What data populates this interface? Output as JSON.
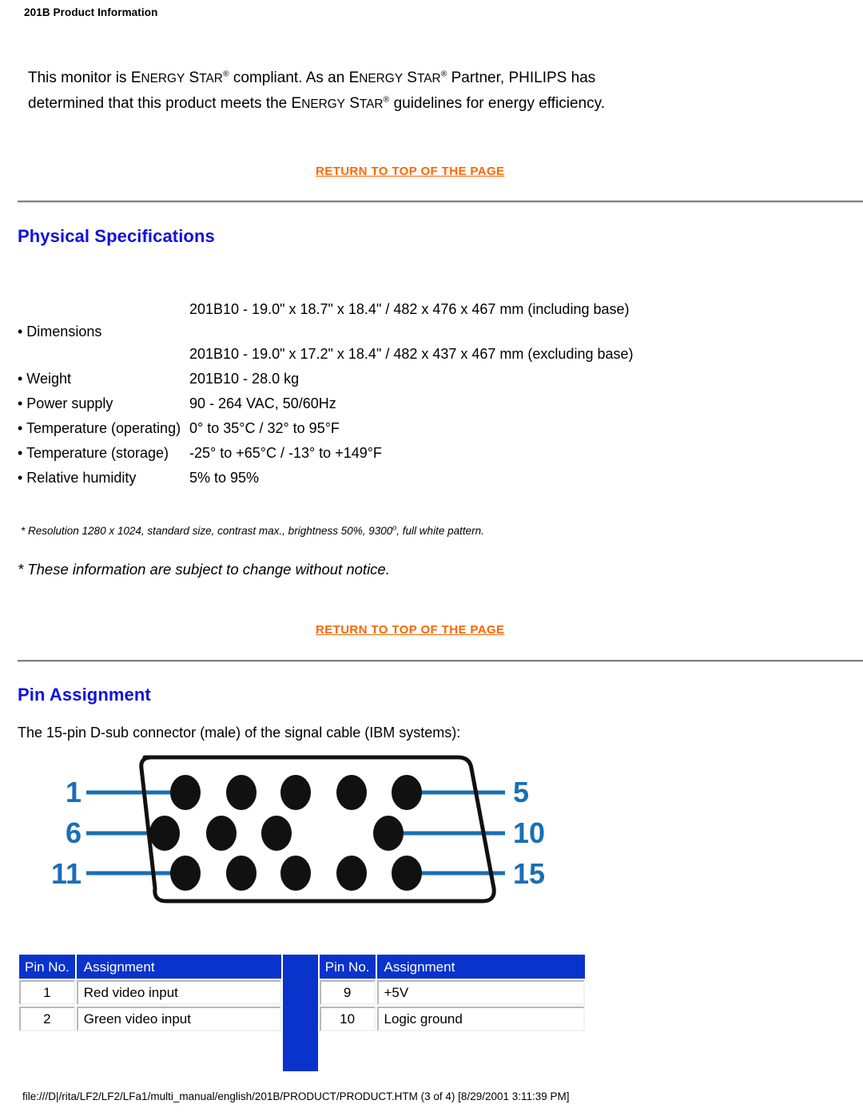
{
  "document": {
    "header_title": "201B Product Information",
    "footer_path": "file:///D|/rita/LF2/LF2/LFa1/multi_manual/english/201B/PRODUCT/PRODUCT.HTM (3 of 4) [8/29/2001 3:11:39 PM]"
  },
  "colors": {
    "link_orange": "#ff6600",
    "heading_blue": "#1111dd",
    "table_header_blue": "#0a33cc",
    "diagram_blue": "#1a6fb5",
    "rule_gray": "#808080"
  },
  "intro": {
    "part1": "This monitor is ",
    "energy_star_1": "ENERGY STAR",
    "part2": " compliant. ",
    "as_an": "As an ",
    "energy_star_2": "ENERGY STAR",
    "part3": " Partner, ",
    "philips": "PHILIPS",
    "part4": " has determined that this product meets the ",
    "energy_star_3": "ENERGY STAR",
    "part5": " guidelines for energy efficiency.",
    "registered_mark": "®"
  },
  "links": {
    "return_to_top": "RETURN TO TOP OF THE PAGE"
  },
  "sections": {
    "physical_specifications": "Physical Specifications",
    "pin_assignment": "Pin Assignment"
  },
  "specs": {
    "rows": [
      {
        "label": "• Dimensions",
        "values": [
          "201B10 - 19.0\" x 18.7\" x 18.4\" / 482 x 476 x 467 mm (including base)",
          "201B10 - 19.0\" x 17.2\" x 18.4\" / 482 x 437 x 467 mm (excluding base)"
        ]
      },
      {
        "label": "• Weight",
        "values": [
          "201B10 - 28.0 kg"
        ]
      },
      {
        "label": "• Power supply",
        "values": [
          "90 - 264 VAC, 50/60Hz"
        ]
      },
      {
        "label": "• Temperature (operating)",
        "values": [
          "0° to 35°C / 32° to 95°F"
        ]
      },
      {
        "label": "• Temperature (storage)",
        "values": [
          "-25° to +65°C / -13° to +149°F"
        ]
      },
      {
        "label": "• Relative humidity",
        "values": [
          "5% to 95%"
        ]
      }
    ]
  },
  "footnotes": {
    "resolution_note_a": "* Resolution 1280 x 1024, standard size, contrast max., brightness 50%, 9300",
    "resolution_note_sup": "o",
    "resolution_note_b": ", full white pattern.",
    "subject_to_change": "* These information are subject to change without notice."
  },
  "pin_assignment": {
    "intro": "The 15-pin D-sub connector (male) of the signal cable (IBM systems):",
    "diagram": {
      "labels": [
        "1",
        "5",
        "6",
        "10",
        "11",
        "15"
      ],
      "row_counts": [
        5,
        4,
        5
      ],
      "total_pins": 15
    },
    "table_headers": {
      "pin_no": "Pin No.",
      "assignment": "Assignment"
    },
    "left_rows": [
      {
        "pin": "1",
        "assignment": "Red video input"
      },
      {
        "pin": "2",
        "assignment": "Green video input"
      }
    ],
    "right_rows": [
      {
        "pin": "9",
        "assignment": "+5V"
      },
      {
        "pin": "10",
        "assignment": "Logic ground"
      }
    ]
  }
}
